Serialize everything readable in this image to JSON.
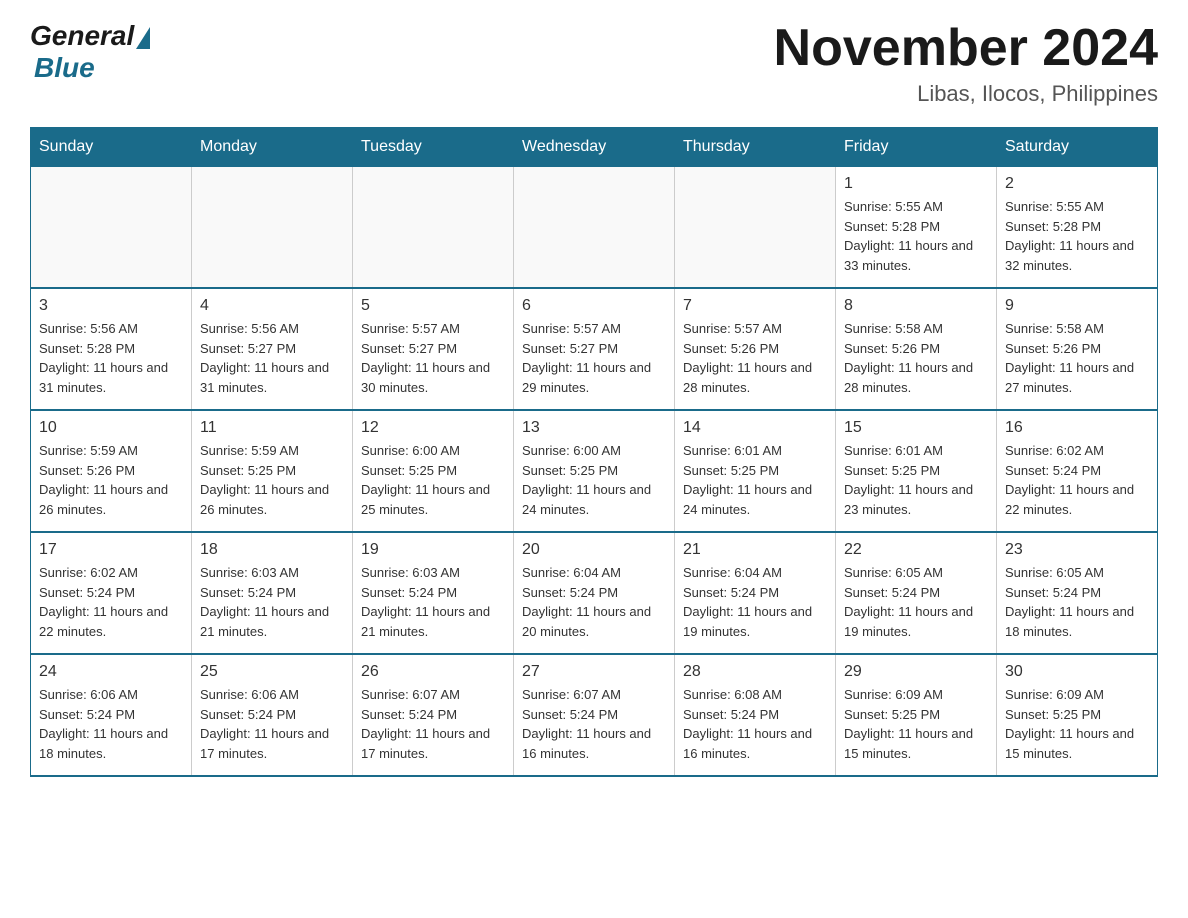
{
  "header": {
    "logo": {
      "general": "General",
      "blue": "Blue"
    },
    "title": "November 2024",
    "subtitle": "Libas, Ilocos, Philippines"
  },
  "weekdays": [
    "Sunday",
    "Monday",
    "Tuesday",
    "Wednesday",
    "Thursday",
    "Friday",
    "Saturday"
  ],
  "weeks": [
    [
      {
        "day": "",
        "info": ""
      },
      {
        "day": "",
        "info": ""
      },
      {
        "day": "",
        "info": ""
      },
      {
        "day": "",
        "info": ""
      },
      {
        "day": "",
        "info": ""
      },
      {
        "day": "1",
        "info": "Sunrise: 5:55 AM\nSunset: 5:28 PM\nDaylight: 11 hours and 33 minutes."
      },
      {
        "day": "2",
        "info": "Sunrise: 5:55 AM\nSunset: 5:28 PM\nDaylight: 11 hours and 32 minutes."
      }
    ],
    [
      {
        "day": "3",
        "info": "Sunrise: 5:56 AM\nSunset: 5:28 PM\nDaylight: 11 hours and 31 minutes."
      },
      {
        "day": "4",
        "info": "Sunrise: 5:56 AM\nSunset: 5:27 PM\nDaylight: 11 hours and 31 minutes."
      },
      {
        "day": "5",
        "info": "Sunrise: 5:57 AM\nSunset: 5:27 PM\nDaylight: 11 hours and 30 minutes."
      },
      {
        "day": "6",
        "info": "Sunrise: 5:57 AM\nSunset: 5:27 PM\nDaylight: 11 hours and 29 minutes."
      },
      {
        "day": "7",
        "info": "Sunrise: 5:57 AM\nSunset: 5:26 PM\nDaylight: 11 hours and 28 minutes."
      },
      {
        "day": "8",
        "info": "Sunrise: 5:58 AM\nSunset: 5:26 PM\nDaylight: 11 hours and 28 minutes."
      },
      {
        "day": "9",
        "info": "Sunrise: 5:58 AM\nSunset: 5:26 PM\nDaylight: 11 hours and 27 minutes."
      }
    ],
    [
      {
        "day": "10",
        "info": "Sunrise: 5:59 AM\nSunset: 5:26 PM\nDaylight: 11 hours and 26 minutes."
      },
      {
        "day": "11",
        "info": "Sunrise: 5:59 AM\nSunset: 5:25 PM\nDaylight: 11 hours and 26 minutes."
      },
      {
        "day": "12",
        "info": "Sunrise: 6:00 AM\nSunset: 5:25 PM\nDaylight: 11 hours and 25 minutes."
      },
      {
        "day": "13",
        "info": "Sunrise: 6:00 AM\nSunset: 5:25 PM\nDaylight: 11 hours and 24 minutes."
      },
      {
        "day": "14",
        "info": "Sunrise: 6:01 AM\nSunset: 5:25 PM\nDaylight: 11 hours and 24 minutes."
      },
      {
        "day": "15",
        "info": "Sunrise: 6:01 AM\nSunset: 5:25 PM\nDaylight: 11 hours and 23 minutes."
      },
      {
        "day": "16",
        "info": "Sunrise: 6:02 AM\nSunset: 5:24 PM\nDaylight: 11 hours and 22 minutes."
      }
    ],
    [
      {
        "day": "17",
        "info": "Sunrise: 6:02 AM\nSunset: 5:24 PM\nDaylight: 11 hours and 22 minutes."
      },
      {
        "day": "18",
        "info": "Sunrise: 6:03 AM\nSunset: 5:24 PM\nDaylight: 11 hours and 21 minutes."
      },
      {
        "day": "19",
        "info": "Sunrise: 6:03 AM\nSunset: 5:24 PM\nDaylight: 11 hours and 21 minutes."
      },
      {
        "day": "20",
        "info": "Sunrise: 6:04 AM\nSunset: 5:24 PM\nDaylight: 11 hours and 20 minutes."
      },
      {
        "day": "21",
        "info": "Sunrise: 6:04 AM\nSunset: 5:24 PM\nDaylight: 11 hours and 19 minutes."
      },
      {
        "day": "22",
        "info": "Sunrise: 6:05 AM\nSunset: 5:24 PM\nDaylight: 11 hours and 19 minutes."
      },
      {
        "day": "23",
        "info": "Sunrise: 6:05 AM\nSunset: 5:24 PM\nDaylight: 11 hours and 18 minutes."
      }
    ],
    [
      {
        "day": "24",
        "info": "Sunrise: 6:06 AM\nSunset: 5:24 PM\nDaylight: 11 hours and 18 minutes."
      },
      {
        "day": "25",
        "info": "Sunrise: 6:06 AM\nSunset: 5:24 PM\nDaylight: 11 hours and 17 minutes."
      },
      {
        "day": "26",
        "info": "Sunrise: 6:07 AM\nSunset: 5:24 PM\nDaylight: 11 hours and 17 minutes."
      },
      {
        "day": "27",
        "info": "Sunrise: 6:07 AM\nSunset: 5:24 PM\nDaylight: 11 hours and 16 minutes."
      },
      {
        "day": "28",
        "info": "Sunrise: 6:08 AM\nSunset: 5:24 PM\nDaylight: 11 hours and 16 minutes."
      },
      {
        "day": "29",
        "info": "Sunrise: 6:09 AM\nSunset: 5:25 PM\nDaylight: 11 hours and 15 minutes."
      },
      {
        "day": "30",
        "info": "Sunrise: 6:09 AM\nSunset: 5:25 PM\nDaylight: 11 hours and 15 minutes."
      }
    ]
  ]
}
